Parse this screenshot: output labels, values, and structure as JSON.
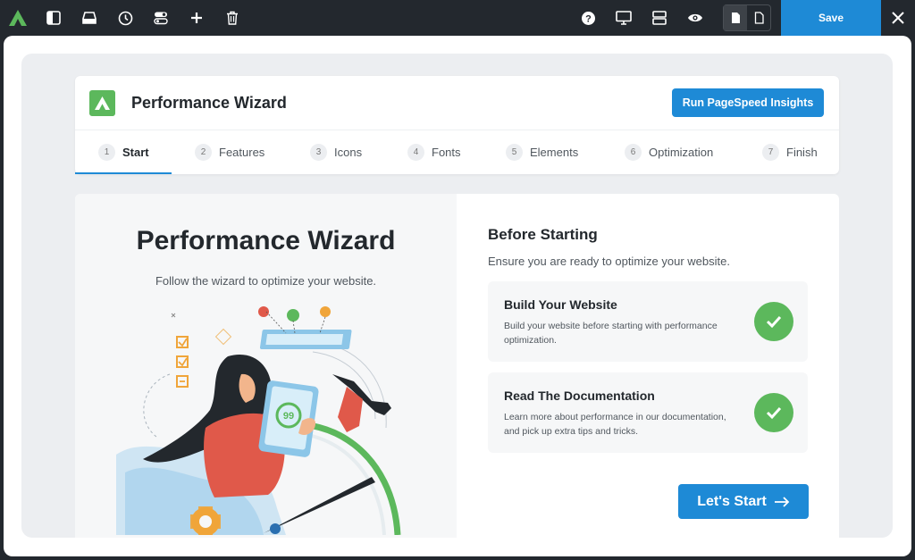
{
  "toolbar": {
    "left_icons": [
      "brand-logo-icon",
      "sidebar-toggle-icon",
      "inbox-icon",
      "history-icon",
      "toggles-icon",
      "add-icon",
      "trash-icon"
    ],
    "right_icons": [
      "help-icon",
      "desktop-icon",
      "layout-icon",
      "preview-eye-icon"
    ],
    "save_label": "Save"
  },
  "header": {
    "title": "Performance Wizard",
    "pagespeed_button": "Run PageSpeed Insights"
  },
  "tabs": [
    {
      "num": "1",
      "label": "Start",
      "active": true
    },
    {
      "num": "2",
      "label": "Features"
    },
    {
      "num": "3",
      "label": "Icons"
    },
    {
      "num": "4",
      "label": "Fonts"
    },
    {
      "num": "5",
      "label": "Elements"
    },
    {
      "num": "6",
      "label": "Optimization"
    },
    {
      "num": "7",
      "label": "Finish"
    }
  ],
  "hero": {
    "title": "Performance Wizard",
    "subtitle": "Follow the wizard to optimize your website.",
    "gauge_value": "99"
  },
  "before_starting": {
    "title": "Before Starting",
    "subtitle": "Ensure you are ready to optimize your website.",
    "items": [
      {
        "title": "Build Your Website",
        "description": "Build your website before starting with performance optimization.",
        "checked": true
      },
      {
        "title": "Read The Documentation",
        "description": "Learn more about performance in our documentation, and pick up extra tips and tricks.",
        "checked": true
      }
    ],
    "start_button": "Let's Start"
  },
  "colors": {
    "accent": "#1e8ad6",
    "success": "#5cb85c",
    "toolbar": "#23282e"
  }
}
